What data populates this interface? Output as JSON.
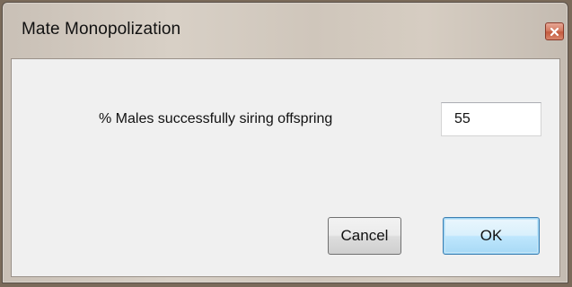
{
  "window": {
    "title": "Mate Monopolization"
  },
  "form": {
    "label": "% Males successfully siring offspring",
    "value": "55"
  },
  "buttons": {
    "cancel_label": "Cancel",
    "ok_label": "OK"
  },
  "icons": {
    "close": "close-icon"
  },
  "colors": {
    "close_button": "#c45a3e",
    "ok_button_border": "#3c7fb1"
  }
}
